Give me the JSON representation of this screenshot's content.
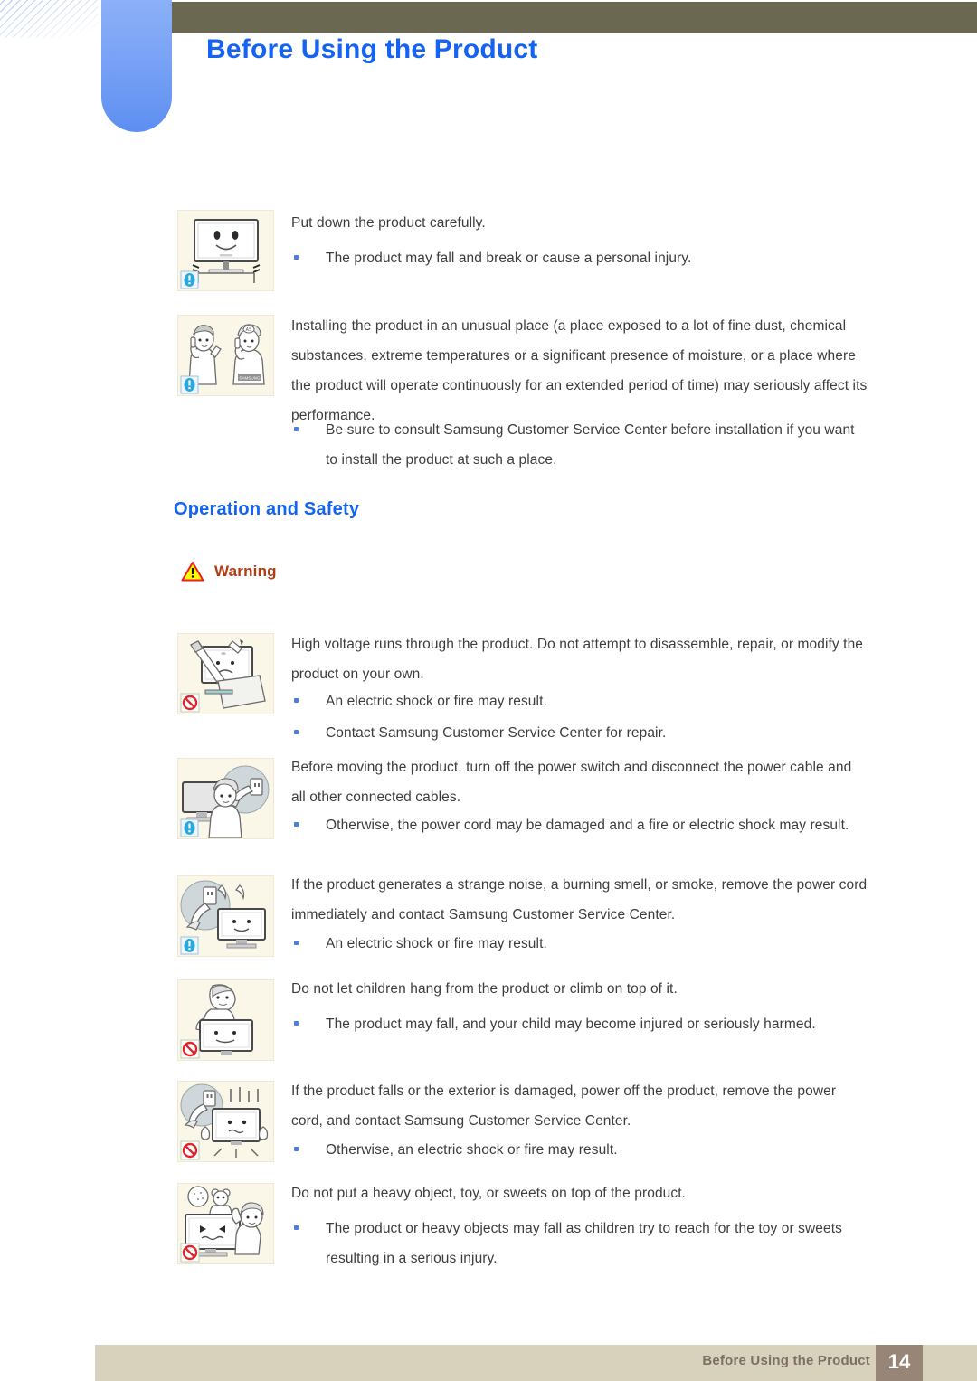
{
  "header": {
    "chapter_title": "Before Using the Product",
    "bar_color": "#6b6851",
    "accent_color": "#1463f3"
  },
  "blocks": [
    {
      "icon": "monitor-smiley-caution-icon",
      "badge": "info-blue",
      "paragraphs": [
        "Put down the product carefully."
      ],
      "bullets": [
        "The product may fall and break or cause a personal injury."
      ]
    },
    {
      "icon": "two-people-phone-call-icon",
      "badge": "info-blue",
      "paragraphs": [
        "Installing the product in an unusual place (a place exposed to a lot of fine dust, chemical substances, extreme temperatures or a significant presence of moisture, or a place where the product will operate continuously for an extended period of time) may seriously affect its performance."
      ],
      "bullets": [
        "Be sure to consult Samsung Customer Service Center before installation if you want to install the product at such a place."
      ]
    }
  ],
  "section": {
    "heading": "Operation and Safety",
    "warning_label": "Warning",
    "warning_color": "#b23c12",
    "warning_triangle_fill": "#ffff00",
    "warning_triangle_stroke": "#ee1c25"
  },
  "warning_blocks": [
    {
      "icon": "screwdriver-disassemble-prohibited-icon",
      "badge": "prohibited-red",
      "paragraphs": [
        "High voltage runs through the product. Do not attempt to disassemble, repair, or modify the product on your own."
      ],
      "bullets": [
        "An electric shock or fire may result.",
        "Contact Samsung Customer Service Center for repair."
      ]
    },
    {
      "icon": "unplug-before-moving-icon",
      "badge": "info-blue",
      "paragraphs": [
        "Before moving the product, turn off the power switch and disconnect the power cable and all other connected cables."
      ],
      "bullets": [
        "Otherwise, the power cord may be damaged and a fire or electric shock may result."
      ]
    },
    {
      "icon": "smoke-burning-smell-unplug-icon",
      "badge": "info-blue",
      "paragraphs": [
        "If the product generates a strange noise, a burning smell, or smoke, remove the power cord immediately and contact Samsung Customer Service Center."
      ],
      "bullets": [
        "An electric shock or fire may result."
      ]
    },
    {
      "icon": "child-hanging-on-monitor-prohibited-icon",
      "badge": "prohibited-red",
      "paragraphs": [
        "Do not let children hang from the product or climb on top of it."
      ],
      "bullets": [
        "The product may fall, and your child may become injured or seriously harmed."
      ]
    },
    {
      "icon": "product-fallen-damaged-unplug-icon",
      "badge": "prohibited-red",
      "paragraphs": [
        "If the product falls or the exterior is damaged, power off the product, remove the power cord, and contact Samsung Customer Service Center."
      ],
      "bullets": [
        "Otherwise, an electric shock or fire may result."
      ]
    },
    {
      "icon": "heavy-object-toy-on-product-prohibited-icon",
      "badge": "prohibited-red",
      "paragraphs": [
        "Do not put a heavy object, toy, or sweets on top of the product."
      ],
      "bullets": [
        "The product or heavy objects may fall as children try to reach for the toy or sweets resulting in a serious injury."
      ]
    }
  ],
  "footer": {
    "text": "Before Using the Product",
    "page_number": "14",
    "bar_color": "#d8d2bd",
    "page_box_color": "#978678"
  }
}
